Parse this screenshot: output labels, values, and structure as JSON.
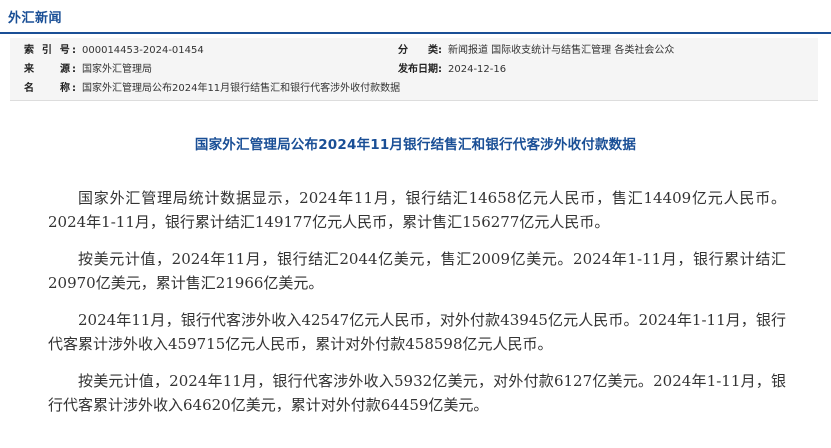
{
  "header": {
    "section_title": "外汇新闻"
  },
  "meta": {
    "index_label": "索 引 号:",
    "index_value": "000014453-2024-01454",
    "source_label": "来　　源:",
    "source_value": "国家外汇管理局",
    "name_label": "名　　称:",
    "name_value": "国家外汇管理局公布2024年11月银行结售汇和银行代客涉外收付款数据",
    "category_label": "分　　类:",
    "category_value": "新闻报道  国际收支统计与结售汇管理  各类社会公众",
    "date_label": "发布日期:",
    "date_value": "2024-12-16"
  },
  "article": {
    "title": "国家外汇管理局公布2024年11月银行结售汇和银行代客涉外收付款数据",
    "paragraphs": [
      "国家外汇管理局统计数据显示，2024年11月，银行结汇14658亿元人民币，售汇14409亿元人民币。2024年1-11月，银行累计结汇149177亿元人民币，累计售汇156277亿元人民币。",
      "按美元计值，2024年11月，银行结汇2044亿美元，售汇2009亿美元。2024年1-11月，银行累计结汇20970亿美元，累计售汇21966亿美元。",
      "2024年11月，银行代客涉外收入42547亿元人民币，对外付款43945亿元人民币。2024年1-11月，银行代客累计涉外收入459715亿元人民币，累计对外付款458598亿元人民币。",
      "按美元计值，2024年11月，银行代客涉外收入5932亿美元，对外付款6127亿美元。2024年1-11月，银行代客累计涉外收入64620亿美元，累计对外付款64459亿美元。"
    ]
  }
}
